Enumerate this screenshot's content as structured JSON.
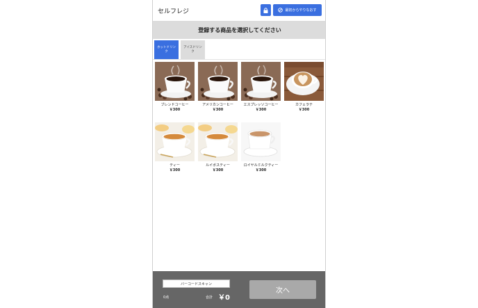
{
  "header": {
    "title": "セルフレジ",
    "lock_icon": "lock-icon",
    "restart_label": "最初からやりなおす",
    "restart_icon": "cancel-circle-icon"
  },
  "banner": {
    "text": "登録する商品を選択してください"
  },
  "tabs": [
    {
      "label": "ホットドリンク",
      "active": true
    },
    {
      "label": "アイスドリンク",
      "active": false
    }
  ],
  "products": [
    {
      "name": "ブレンドコーヒー",
      "price": "￥300"
    },
    {
      "name": "アメリカンコーヒー",
      "price": "￥300"
    },
    {
      "name": "エスプレッソコーヒー",
      "price": "￥300"
    },
    {
      "name": "カフェラテ",
      "price": "￥300"
    },
    {
      "name": "ティー",
      "price": "￥300"
    },
    {
      "name": "ルイボスティー",
      "price": "￥300"
    },
    {
      "name": "ロイヤルミルクティー",
      "price": "￥300"
    }
  ],
  "footer": {
    "scan_label": "バーコードスキャン",
    "count": "0点",
    "total_label": "合計",
    "total_value": "￥0",
    "next_label": "次へ"
  },
  "colors": {
    "accent": "#3a6fe0",
    "footer_bg": "#666666",
    "banner_bg": "#dcdcdc",
    "disabled": "#a9a9a9"
  }
}
